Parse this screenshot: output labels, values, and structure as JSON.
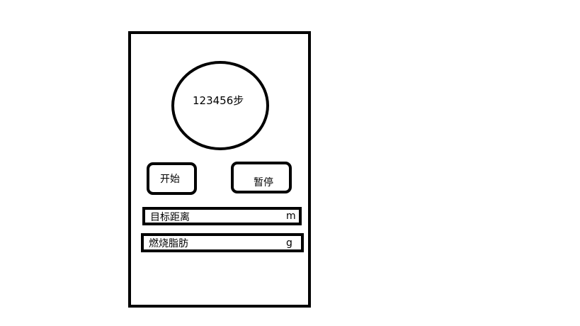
{
  "pedometer": {
    "step_display": "123456步"
  },
  "controls": {
    "start_label": "开始",
    "pause_label": "暂停"
  },
  "fields": {
    "target_distance": {
      "label": "目标距离",
      "unit": "m"
    },
    "fat_burned": {
      "label": "燃烧脂肪",
      "unit": "g"
    }
  }
}
